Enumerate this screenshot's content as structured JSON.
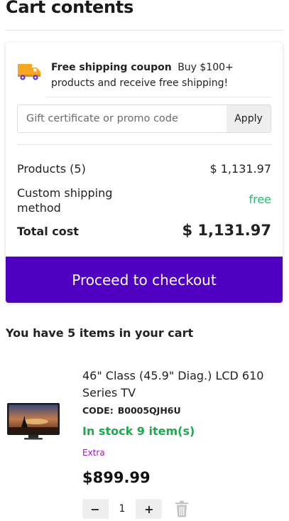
{
  "page": {
    "title": "Cart contents"
  },
  "coupon": {
    "title": "Free shipping coupon",
    "text": "Buy $100+ products and receive free shipping!",
    "icon": "delivery-truck-icon"
  },
  "promo": {
    "placeholder": "Gift certificate or promo code",
    "apply_label": "Apply"
  },
  "summary": {
    "products_label": "Products (5)",
    "products_value": "$ 1,131.97",
    "shipping_label": "Custom shipping method",
    "shipping_value": "free",
    "total_label": "Total cost",
    "total_value": "$ 1,131.97"
  },
  "checkout": {
    "label": "Proceed to checkout"
  },
  "items_heading": "You have 5 items in your cart",
  "items": [
    {
      "name": "46\" Class (45.9\" Diag.) LCD 610 Series TV",
      "code_label": "CODE:",
      "code": "B0005QJH6U",
      "stock": "In stock 9 item(s)",
      "extra": "Extra",
      "price": "$899.99",
      "quantity": "1",
      "minus_label": "−",
      "plus_label": "+"
    }
  ],
  "colors": {
    "accent": "#5000c0",
    "free": "#1fbf6e",
    "in_stock": "#1fa84f",
    "extra": "#9b1ab8",
    "truck": "#f5a623"
  }
}
